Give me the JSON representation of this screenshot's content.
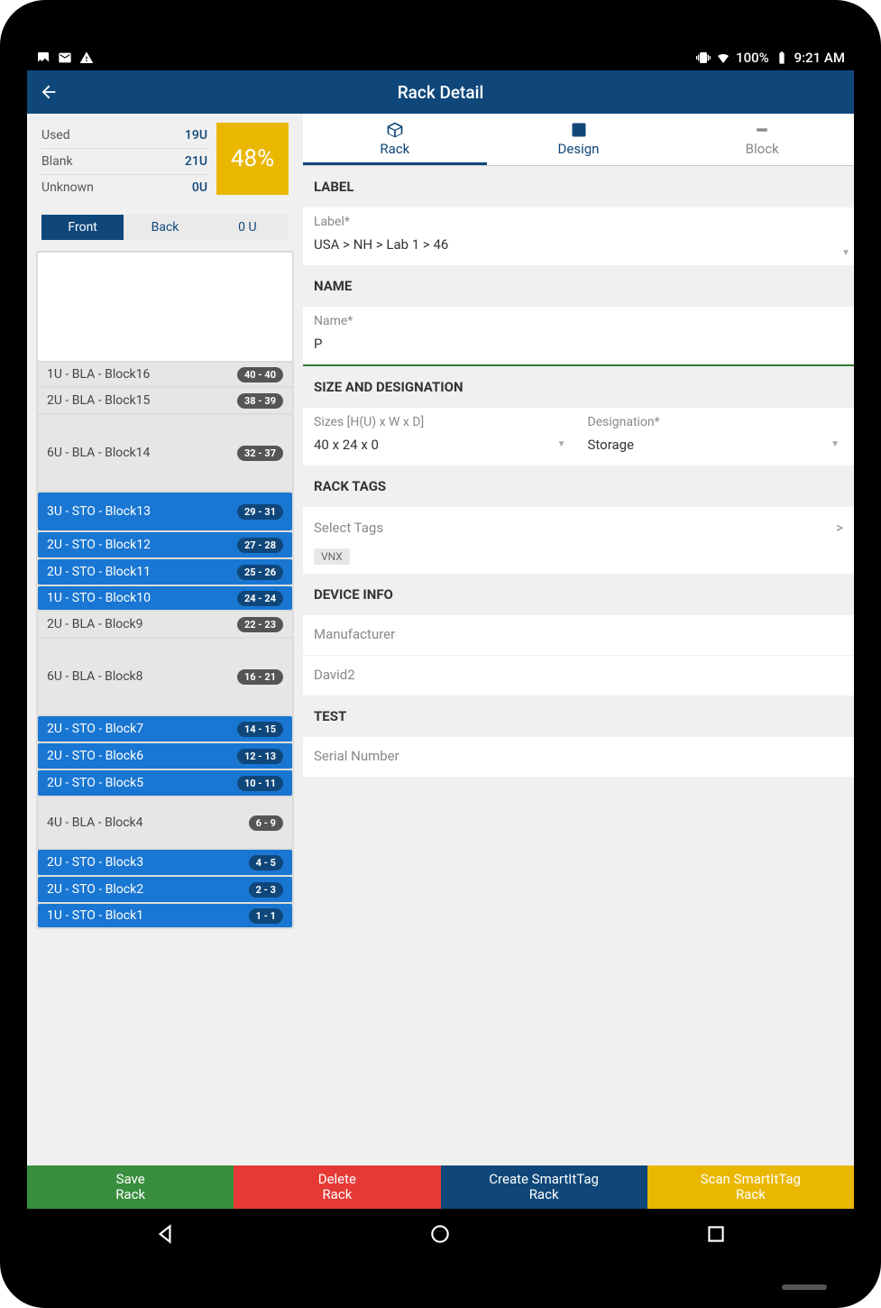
{
  "status": {
    "battery": "100%",
    "time": "9:21 AM"
  },
  "appbar": {
    "title": "Rack Detail"
  },
  "summary": {
    "used_label": "Used",
    "used_value": "19U",
    "blank_label": "Blank",
    "blank_value": "21U",
    "unknown_label": "Unknown",
    "unknown_value": "0U",
    "percent": "48%"
  },
  "segmented": {
    "front": "Front",
    "back": "Back",
    "units": "0 U"
  },
  "rack_blocks": [
    {
      "u": 1,
      "type": "bla",
      "label": "1U - BLA - Block16",
      "range": "40 - 40"
    },
    {
      "u": 2,
      "type": "bla",
      "label": "2U - BLA - Block15",
      "range": "38 - 39"
    },
    {
      "u": 6,
      "type": "bla",
      "label": "6U - BLA - Block14",
      "range": "32 - 37"
    },
    {
      "u": 3,
      "type": "sto",
      "label": "3U - STO - Block13",
      "range": "29 - 31"
    },
    {
      "u": 2,
      "type": "sto",
      "label": "2U - STO - Block12",
      "range": "27 - 28"
    },
    {
      "u": 2,
      "type": "sto",
      "label": "2U - STO - Block11",
      "range": "25 - 26"
    },
    {
      "u": 1,
      "type": "sto",
      "label": "1U - STO - Block10",
      "range": "24 - 24"
    },
    {
      "u": 2,
      "type": "bla",
      "label": "2U - BLA - Block9",
      "range": "22 - 23"
    },
    {
      "u": 6,
      "type": "bla",
      "label": "6U - BLA - Block8",
      "range": "16 - 21"
    },
    {
      "u": 2,
      "type": "sto",
      "label": "2U - STO - Block7",
      "range": "14 - 15"
    },
    {
      "u": 2,
      "type": "sto",
      "label": "2U - STO - Block6",
      "range": "12 - 13"
    },
    {
      "u": 2,
      "type": "sto",
      "label": "2U - STO - Block5",
      "range": "10 - 11"
    },
    {
      "u": 4,
      "type": "bla",
      "label": "4U - BLA - Block4",
      "range": "6 - 9"
    },
    {
      "u": 2,
      "type": "sto",
      "label": "2U - STO - Block3",
      "range": "4 - 5"
    },
    {
      "u": 2,
      "type": "sto",
      "label": "2U - STO - Block2",
      "range": "2 - 3"
    },
    {
      "u": 1,
      "type": "sto",
      "label": "1U - STO - Block1",
      "range": "1 - 1"
    }
  ],
  "tabs": {
    "rack": "Rack",
    "design": "Design",
    "block": "Block"
  },
  "form": {
    "label_section": "LABEL",
    "label_field": "Label*",
    "label_value": "USA > NH > Lab 1 > 46",
    "name_section": "NAME",
    "name_field": "Name*",
    "name_value": "P",
    "size_section": "SIZE AND DESIGNATION",
    "size_field": "Sizes [H(U) x W x D]",
    "size_value": "40 x 24 x 0",
    "designation_field": "Designation*",
    "designation_value": "Storage",
    "tags_section": "RACK TAGS",
    "tags_placeholder": "Select Tags",
    "tags_chevron": ">",
    "tag_chip": "VNX",
    "device_section": "DEVICE INFO",
    "manufacturer_placeholder": "Manufacturer",
    "device_value": "David2",
    "test_section": "TEST",
    "serial_placeholder": "Serial Number"
  },
  "actions": {
    "save": "Save\nRack",
    "delete": "Delete\nRack",
    "create": "Create SmartItTag\nRack",
    "scan": "Scan SmartItTag\nRack"
  }
}
